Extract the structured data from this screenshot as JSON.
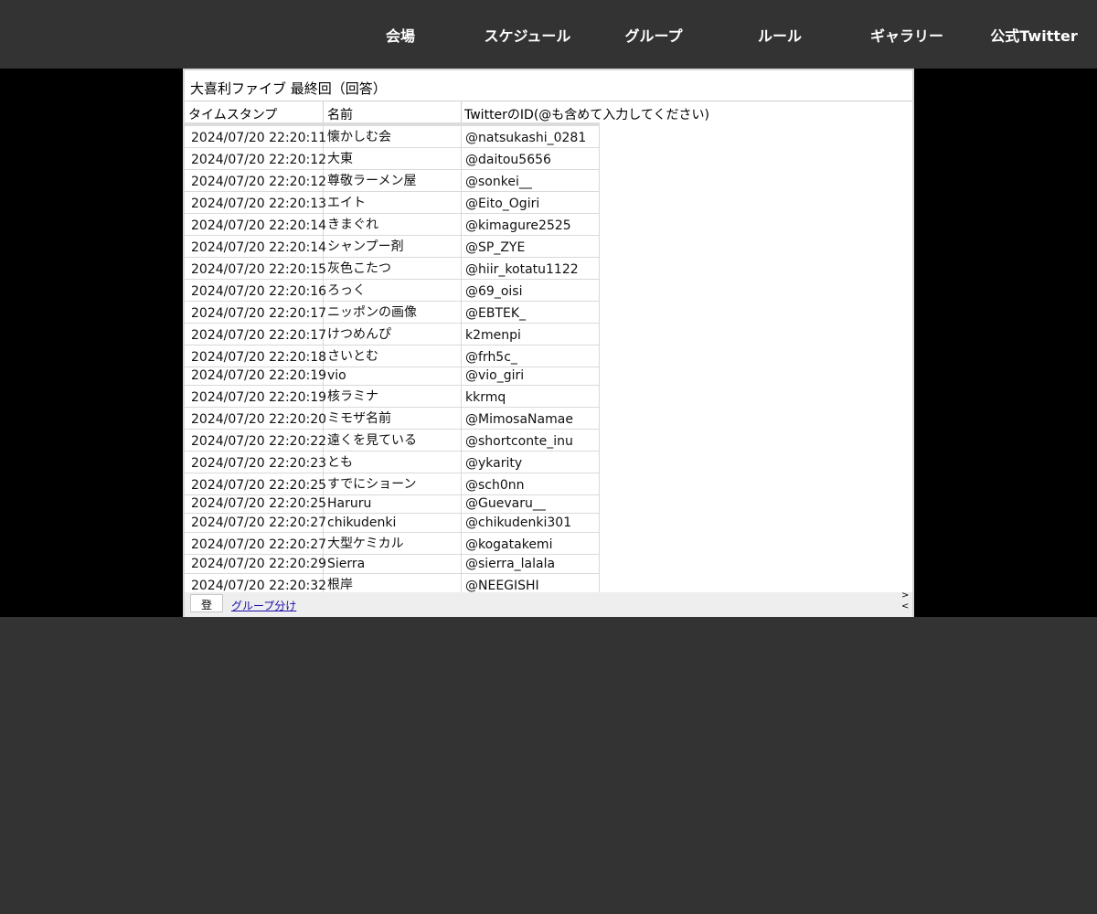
{
  "nav": {
    "items": [
      {
        "label": "会場"
      },
      {
        "label": "スケジュール"
      },
      {
        "label": "グループ"
      },
      {
        "label": "ルール"
      },
      {
        "label": "ギャラリー"
      },
      {
        "label": "公式Twitter"
      }
    ]
  },
  "sheet": {
    "title": "大喜利ファイブ 最終回（回答）",
    "columns": [
      "タイムスタンプ",
      "名前",
      "TwitterのID(@も含めて入力してください)"
    ],
    "rows": [
      [
        "2024/07/20 22:20:11",
        "懐かしむ会",
        "@natsukashi_0281"
      ],
      [
        "2024/07/20 22:20:12",
        "大東",
        "@daitou5656"
      ],
      [
        "2024/07/20 22:20:12",
        "尊敬ラーメン屋",
        "@sonkei__"
      ],
      [
        "2024/07/20 22:20:13",
        "エイト",
        "@Eito_Ogiri"
      ],
      [
        "2024/07/20 22:20:14",
        "きまぐれ",
        "@kimagure2525"
      ],
      [
        "2024/07/20 22:20:14",
        "シャンプー剤",
        "@SP_ZYE"
      ],
      [
        "2024/07/20 22:20:15",
        "灰色こたつ",
        "@hiir_kotatu1122"
      ],
      [
        "2024/07/20 22:20:16",
        "ろっく",
        "@69_oisi"
      ],
      [
        "2024/07/20 22:20:17",
        "ニッポンの画像",
        "@EBTEK_"
      ],
      [
        "2024/07/20 22:20:17",
        "けつめんぴ",
        "k2menpi"
      ],
      [
        "2024/07/20 22:20:18",
        "さいとむ",
        "@frh5c_"
      ],
      [
        "2024/07/20 22:20:19",
        "vio",
        "@vio_giri"
      ],
      [
        "2024/07/20 22:20:19",
        "核ラミナ",
        "kkrmq"
      ],
      [
        "2024/07/20 22:20:20",
        "ミモザ名前",
        "@MimosaNamae"
      ],
      [
        "2024/07/20 22:20:22",
        "遠くを見ている",
        "@shortconte_inu"
      ],
      [
        "2024/07/20 22:20:23",
        "とも",
        "@ykarity"
      ],
      [
        "2024/07/20 22:20:25",
        "すでにショーン",
        "@sch0nn"
      ],
      [
        "2024/07/20 22:20:25",
        "Haruru",
        "@Guevaru__"
      ],
      [
        "2024/07/20 22:20:27",
        "chikudenki",
        "@chikudenki301"
      ],
      [
        "2024/07/20 22:20:27",
        "大型ケミカル",
        "@kogatakemi"
      ],
      [
        "2024/07/20 22:20:29",
        "Sierra",
        "@sierra_lalala"
      ],
      [
        "2024/07/20 22:20:32",
        "根岸",
        "@NEEGISHI"
      ]
    ]
  },
  "bottom": {
    "register_label": "登録",
    "tab_label": "グループ分け",
    "next_arrow": ">",
    "prev_arrow": "<"
  }
}
